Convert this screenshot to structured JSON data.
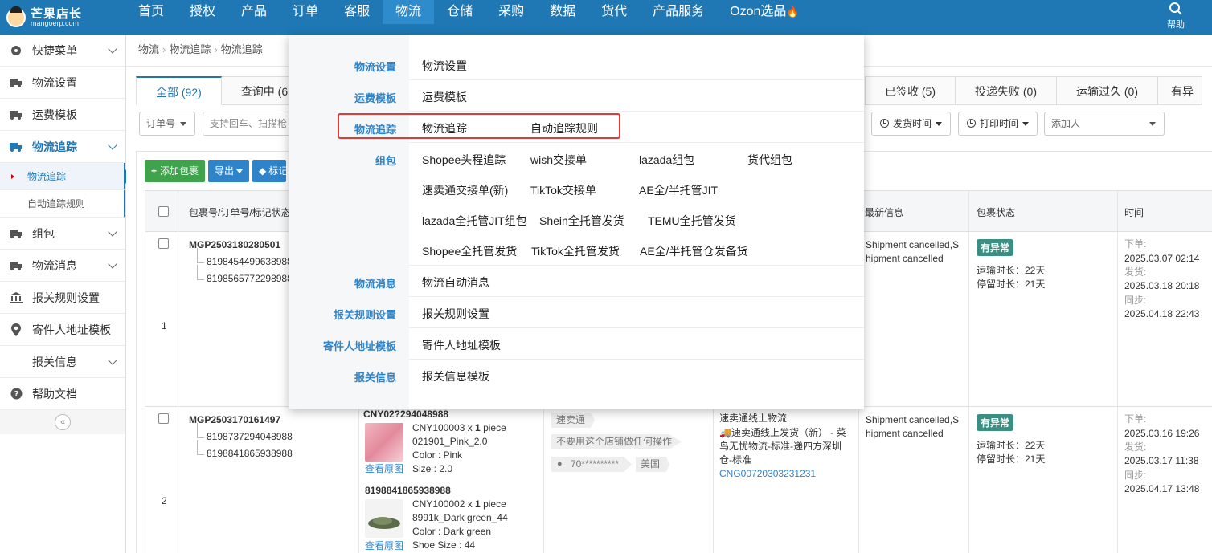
{
  "brand": {
    "title": "芒果店长",
    "subtitle": "mangoerp.com"
  },
  "nav": [
    {
      "label": "首页"
    },
    {
      "label": "授权"
    },
    {
      "label": "产品"
    },
    {
      "label": "订单"
    },
    {
      "label": "客服"
    },
    {
      "label": "物流"
    },
    {
      "label": "仓储"
    },
    {
      "label": "采购"
    },
    {
      "label": "数据"
    },
    {
      "label": "货代"
    },
    {
      "label": "产品服务"
    },
    {
      "label": "Ozon选品"
    }
  ],
  "help_label": "帮助",
  "sidebar": {
    "items": [
      {
        "label": "快捷菜单"
      },
      {
        "label": "物流设置"
      },
      {
        "label": "运费模板"
      },
      {
        "label": "物流追踪"
      },
      {
        "label": "组包"
      },
      {
        "label": "物流消息"
      },
      {
        "label": "报关规则设置"
      },
      {
        "label": "寄件人地址模板"
      },
      {
        "label": "报关信息"
      },
      {
        "label": "帮助文档"
      }
    ],
    "sub_items": [
      {
        "label": "物流追踪"
      },
      {
        "label": "自动追踪规则"
      }
    ],
    "collapse_glyph": "«"
  },
  "breadcrumb": [
    "物流",
    "物流追踪",
    "物流追踪"
  ],
  "tabs": [
    {
      "label": "全部 (92)"
    },
    {
      "label": "查询中 (6"
    }
  ],
  "tabs_right": [
    {
      "label": "已签收 (5)"
    },
    {
      "label": "投递失败 (0)"
    },
    {
      "label": "运输过久 (0)"
    },
    {
      "label": "有异"
    }
  ],
  "filters": {
    "order_no": "订单号",
    "search_placeholder": "支持回车、扫描枪",
    "ship_time": "发货时间",
    "print_time": "打印时间",
    "add_person": "添加人"
  },
  "actions": {
    "add_package": "添加包裹",
    "export": "导出",
    "mark": "标记"
  },
  "table": {
    "headers": {
      "package": "包裹号/订单号/标记状态",
      "latest": "最新信息",
      "status": "包裹状态",
      "time": "时间"
    },
    "rows": [
      {
        "index": "1",
        "package_no": "MGP2503180280501",
        "orders": [
          "8198454499638988",
          "8198565772298988"
        ],
        "latest": [
          "Shipment cancelled,S",
          "hipment cancelled"
        ],
        "status_badge": "有异常",
        "transit": "运输时长：22天",
        "stay": "停留时长：21天",
        "times": [
          {
            "label": "下单:",
            "value": "2025.03.07 02:14"
          },
          {
            "label": "发货:",
            "value": "2025.03.18 20:18"
          },
          {
            "label": "同步:",
            "value": "2025.04.18 22:43"
          }
        ]
      },
      {
        "index": "2",
        "package_no": "MGP2503170161497",
        "orders": [
          "8198737294048988",
          "8198841865938988"
        ],
        "products": [
          {
            "order_no": "CNY02?294048988",
            "line1": "CNY100003 x ",
            "qty": "1",
            "unit": " piece",
            "sku": "021901_Pink_2.0",
            "color": "Color : Pink",
            "size": "Size : 2.0",
            "view": "查看原图"
          },
          {
            "order_no": "8198841865938988",
            "line1": "CNY100002 x ",
            "qty": "1",
            "unit": " piece",
            "sku": "8991k_Dark green_44",
            "color": "Color : Dark green",
            "size": "Shoe Size : 44",
            "view": "查看原图"
          }
        ],
        "tags": {
          "platform": "速卖通",
          "note": "不要用这个店铺做任何操作",
          "buyer": "70**********",
          "country": "美国"
        },
        "logistics": {
          "name": "速卖通线上物流",
          "detail": [
            "速卖通线上发货（新） - 菜",
            "鸟无忧物流-标准-递四方深圳",
            "仓-标准"
          ],
          "tracking": "CNG00720303231231"
        },
        "latest": [
          "Shipment cancelled,S",
          "hipment cancelled"
        ],
        "status_badge": "有异常",
        "transit": "运输时长：22天",
        "stay": "停留时长：21天",
        "times": [
          {
            "label": "下单:",
            "value": "2025.03.16 19:26"
          },
          {
            "label": "发货:",
            "value": "2025.03.17 11:38"
          },
          {
            "label": "同步:",
            "value": "2025.04.17 13:48"
          }
        ]
      }
    ]
  },
  "mega_menu": {
    "rows": [
      {
        "category": "物流设置",
        "links": [
          "物流设置"
        ]
      },
      {
        "category": "运费模板",
        "links": [
          "运费模板"
        ]
      },
      {
        "category": "物流追踪",
        "links": [
          "物流追踪",
          "自动追踪规则"
        ]
      },
      {
        "category": "组包",
        "links": [
          "Shopee头程追踪",
          "wish交接单",
          "lazada组包",
          "货代组包",
          "速卖通交接单(新)",
          "TikTok交接单",
          "AE全/半托管JIT",
          "lazada全托管JIT组包",
          "Shein全托管发货",
          "TEMU全托管发货",
          "Shopee全托管发货",
          "TikTok全托管发货",
          "AE全/半托管仓发备货"
        ]
      },
      {
        "category": "物流消息",
        "links": [
          "物流自动消息"
        ]
      },
      {
        "category": "报关规则设置",
        "links": [
          "报关规则设置"
        ]
      },
      {
        "category": "寄件人地址模板",
        "links": [
          "寄件人地址模板"
        ]
      },
      {
        "category": "报关信息",
        "links": [
          "报关信息模板"
        ]
      }
    ]
  },
  "colors": {
    "primary": "#1f78b4",
    "active_nav": "#2f8ccc",
    "highlight": "#e53935",
    "badge": "#3b8e82"
  }
}
